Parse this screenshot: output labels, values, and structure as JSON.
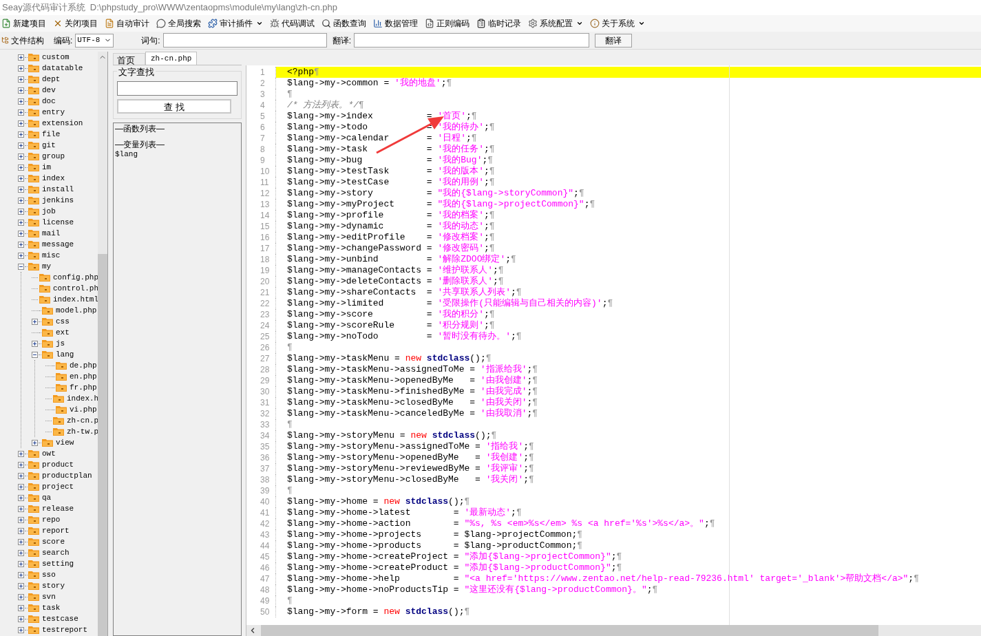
{
  "window": {
    "title": "Seay源代码审计系统  D:\\phpstudy_pro\\WWW\\zentaopms\\module\\my\\lang\\zh-cn.php"
  },
  "toolbar": [
    {
      "label": "新建项目",
      "dropdown": false
    },
    {
      "label": "关闭项目",
      "dropdown": false
    },
    {
      "label": "自动审计",
      "dropdown": false
    },
    {
      "label": "全局搜索",
      "dropdown": false
    },
    {
      "label": "审计插件",
      "dropdown": true
    },
    {
      "label": "代码调试",
      "dropdown": false
    },
    {
      "label": "函数查询",
      "dropdown": false
    },
    {
      "label": "数据管理",
      "dropdown": false
    },
    {
      "label": "正则编码",
      "dropdown": false
    },
    {
      "label": "临时记录",
      "dropdown": false
    },
    {
      "label": "系统配置",
      "dropdown": true
    },
    {
      "label": "关于系统",
      "dropdown": true
    }
  ],
  "options_bar": {
    "file_tab": "文件结构",
    "encoding_label": "编码:",
    "encoding": "UTF-8",
    "phrase_label": "词句:",
    "translate_label": "翻译:",
    "translate_button": "翻译"
  },
  "file_tree": [
    {
      "label": "custom",
      "kind": "branch",
      "expanded": false
    },
    {
      "label": "datatable",
      "kind": "branch",
      "expanded": false
    },
    {
      "label": "dept",
      "kind": "branch",
      "expanded": false
    },
    {
      "label": "dev",
      "kind": "branch",
      "expanded": false
    },
    {
      "label": "doc",
      "kind": "branch",
      "expanded": false
    },
    {
      "label": "entry",
      "kind": "branch",
      "expanded": false
    },
    {
      "label": "extension",
      "kind": "branch",
      "expanded": false
    },
    {
      "label": "file",
      "kind": "branch",
      "expanded": false
    },
    {
      "label": "git",
      "kind": "branch",
      "expanded": false
    },
    {
      "label": "group",
      "kind": "branch",
      "expanded": false
    },
    {
      "label": "im",
      "kind": "branch",
      "expanded": false
    },
    {
      "label": "index",
      "kind": "branch",
      "expanded": false
    },
    {
      "label": "install",
      "kind": "branch",
      "expanded": false
    },
    {
      "label": "jenkins",
      "kind": "branch",
      "expanded": false
    },
    {
      "label": "job",
      "kind": "branch",
      "expanded": false
    },
    {
      "label": "license",
      "kind": "branch",
      "expanded": false
    },
    {
      "label": "mail",
      "kind": "branch",
      "expanded": false
    },
    {
      "label": "message",
      "kind": "branch",
      "expanded": false
    },
    {
      "label": "misc",
      "kind": "branch",
      "expanded": false
    },
    {
      "label": "my",
      "kind": "branch",
      "expanded": true,
      "children": [
        {
          "label": "config.php",
          "kind": "leaf"
        },
        {
          "label": "control.ph",
          "kind": "leaf"
        },
        {
          "label": "index.html",
          "kind": "leaf"
        },
        {
          "label": "model.php",
          "kind": "leaf"
        },
        {
          "label": "css",
          "kind": "branch",
          "expanded": false
        },
        {
          "label": "ext",
          "kind": "leaf"
        },
        {
          "label": "js",
          "kind": "branch",
          "expanded": false
        },
        {
          "label": "lang",
          "kind": "branch",
          "expanded": true,
          "children": [
            {
              "label": "de.php",
              "kind": "leaf"
            },
            {
              "label": "en.php",
              "kind": "leaf"
            },
            {
              "label": "fr.php",
              "kind": "leaf"
            },
            {
              "label": "index.h",
              "kind": "leaf"
            },
            {
              "label": "vi.php",
              "kind": "leaf"
            },
            {
              "label": "zh-cn.p",
              "kind": "leaf"
            },
            {
              "label": "zh-tw.p",
              "kind": "leaf"
            }
          ]
        },
        {
          "label": "view",
          "kind": "branch",
          "expanded": false
        }
      ]
    },
    {
      "label": "owt",
      "kind": "branch",
      "expanded": false
    },
    {
      "label": "product",
      "kind": "branch",
      "expanded": false
    },
    {
      "label": "productplan",
      "kind": "branch",
      "expanded": false
    },
    {
      "label": "project",
      "kind": "branch",
      "expanded": false
    },
    {
      "label": "qa",
      "kind": "branch",
      "expanded": false
    },
    {
      "label": "release",
      "kind": "branch",
      "expanded": false
    },
    {
      "label": "repo",
      "kind": "branch",
      "expanded": false
    },
    {
      "label": "report",
      "kind": "branch",
      "expanded": false
    },
    {
      "label": "score",
      "kind": "branch",
      "expanded": false
    },
    {
      "label": "search",
      "kind": "branch",
      "expanded": false
    },
    {
      "label": "setting",
      "kind": "branch",
      "expanded": false
    },
    {
      "label": "sso",
      "kind": "branch",
      "expanded": false
    },
    {
      "label": "story",
      "kind": "branch",
      "expanded": false
    },
    {
      "label": "svn",
      "kind": "branch",
      "expanded": false
    },
    {
      "label": "task",
      "kind": "branch",
      "expanded": false
    },
    {
      "label": "testcase",
      "kind": "branch",
      "expanded": false
    },
    {
      "label": "testreport",
      "kind": "branch",
      "expanded": false
    }
  ],
  "tabs": [
    {
      "label": "首页",
      "selected": false
    },
    {
      "label": "zh-cn.php",
      "selected": true
    }
  ],
  "find": {
    "title": "文字查找",
    "button": "查 找"
  },
  "outline": [
    {
      "kind": "heading",
      "text": "—函数列表—"
    },
    {
      "kind": "heading",
      "text": "—变量列表—"
    },
    {
      "kind": "item",
      "text": "$lang"
    }
  ],
  "editor": {
    "lines": [
      {
        "n": "1",
        "current": true,
        "segs": [
          {
            "kind": "code",
            "text": "<?php"
          },
          {
            "kind": "mark",
            "text": "¶"
          }
        ]
      },
      {
        "n": "2",
        "current": false,
        "segs": [
          {
            "kind": "code",
            "text": "$lang->my->common = "
          },
          {
            "kind": "string",
            "text": "'我的地盘'"
          },
          {
            "kind": "code",
            "text": ";"
          },
          {
            "kind": "mark",
            "text": "¶"
          }
        ]
      },
      {
        "n": "3",
        "current": false,
        "segs": [
          {
            "kind": "mark",
            "text": "¶"
          }
        ]
      },
      {
        "n": "4",
        "current": false,
        "segs": [
          {
            "kind": "comment",
            "text": "/* 方法列表。*/"
          },
          {
            "kind": "mark",
            "text": "¶"
          }
        ]
      },
      {
        "n": "5",
        "current": false,
        "segs": [
          {
            "kind": "code",
            "text": "$lang->my->index          = "
          },
          {
            "kind": "string",
            "text": "'首页'"
          },
          {
            "kind": "code",
            "text": ";"
          },
          {
            "kind": "mark",
            "text": "¶"
          }
        ]
      },
      {
        "n": "6",
        "current": false,
        "segs": [
          {
            "kind": "code",
            "text": "$lang->my->todo           = "
          },
          {
            "kind": "string",
            "text": "'我的待办'"
          },
          {
            "kind": "code",
            "text": ";"
          },
          {
            "kind": "mark",
            "text": "¶"
          }
        ]
      },
      {
        "n": "7",
        "current": false,
        "segs": [
          {
            "kind": "code",
            "text": "$lang->my->calendar       = "
          },
          {
            "kind": "string",
            "text": "'日程'"
          },
          {
            "kind": "code",
            "text": ";"
          },
          {
            "kind": "mark",
            "text": "¶"
          }
        ]
      },
      {
        "n": "8",
        "current": false,
        "segs": [
          {
            "kind": "code",
            "text": "$lang->my->task           = "
          },
          {
            "kind": "string",
            "text": "'我的任务'"
          },
          {
            "kind": "code",
            "text": ";"
          },
          {
            "kind": "mark",
            "text": "¶"
          }
        ]
      },
      {
        "n": "9",
        "current": false,
        "segs": [
          {
            "kind": "code",
            "text": "$lang->my->bug            = "
          },
          {
            "kind": "string",
            "text": "'我的Bug'"
          },
          {
            "kind": "code",
            "text": ";"
          },
          {
            "kind": "mark",
            "text": "¶"
          }
        ]
      },
      {
        "n": "10",
        "current": false,
        "segs": [
          {
            "kind": "code",
            "text": "$lang->my->testTask       = "
          },
          {
            "kind": "string",
            "text": "'我的版本'"
          },
          {
            "kind": "code",
            "text": ";"
          },
          {
            "kind": "mark",
            "text": "¶"
          }
        ]
      },
      {
        "n": "11",
        "current": false,
        "segs": [
          {
            "kind": "code",
            "text": "$lang->my->testCase       = "
          },
          {
            "kind": "string",
            "text": "'我的用例'"
          },
          {
            "kind": "code",
            "text": ";"
          },
          {
            "kind": "mark",
            "text": "¶"
          }
        ]
      },
      {
        "n": "12",
        "current": false,
        "segs": [
          {
            "kind": "code",
            "text": "$lang->my->story          = "
          },
          {
            "kind": "string",
            "text": "\"我的{$lang->storyCommon}\""
          },
          {
            "kind": "code",
            "text": ";"
          },
          {
            "kind": "mark",
            "text": "¶"
          }
        ]
      },
      {
        "n": "13",
        "current": false,
        "segs": [
          {
            "kind": "code",
            "text": "$lang->my->myProject      = "
          },
          {
            "kind": "string",
            "text": "\"我的{$lang->projectCommon}\""
          },
          {
            "kind": "code",
            "text": ";"
          },
          {
            "kind": "mark",
            "text": "¶"
          }
        ]
      },
      {
        "n": "14",
        "current": false,
        "segs": [
          {
            "kind": "code",
            "text": "$lang->my->profile        = "
          },
          {
            "kind": "string",
            "text": "'我的档案'"
          },
          {
            "kind": "code",
            "text": ";"
          },
          {
            "kind": "mark",
            "text": "¶"
          }
        ]
      },
      {
        "n": "15",
        "current": false,
        "segs": [
          {
            "kind": "code",
            "text": "$lang->my->dynamic        = "
          },
          {
            "kind": "string",
            "text": "'我的动态'"
          },
          {
            "kind": "code",
            "text": ";"
          },
          {
            "kind": "mark",
            "text": "¶"
          }
        ]
      },
      {
        "n": "16",
        "current": false,
        "segs": [
          {
            "kind": "code",
            "text": "$lang->my->editProfile    = "
          },
          {
            "kind": "string",
            "text": "'修改档案'"
          },
          {
            "kind": "code",
            "text": ";"
          },
          {
            "kind": "mark",
            "text": "¶"
          }
        ]
      },
      {
        "n": "17",
        "current": false,
        "segs": [
          {
            "kind": "code",
            "text": "$lang->my->changePassword = "
          },
          {
            "kind": "string",
            "text": "'修改密码'"
          },
          {
            "kind": "code",
            "text": ";"
          },
          {
            "kind": "mark",
            "text": "¶"
          }
        ]
      },
      {
        "n": "18",
        "current": false,
        "segs": [
          {
            "kind": "code",
            "text": "$lang->my->unbind         = "
          },
          {
            "kind": "string",
            "text": "'解除ZDOO绑定'"
          },
          {
            "kind": "code",
            "text": ";"
          },
          {
            "kind": "mark",
            "text": "¶"
          }
        ]
      },
      {
        "n": "19",
        "current": false,
        "segs": [
          {
            "kind": "code",
            "text": "$lang->my->manageContacts = "
          },
          {
            "kind": "string",
            "text": "'维护联系人'"
          },
          {
            "kind": "code",
            "text": ";"
          },
          {
            "kind": "mark",
            "text": "¶"
          }
        ]
      },
      {
        "n": "20",
        "current": false,
        "segs": [
          {
            "kind": "code",
            "text": "$lang->my->deleteContacts = "
          },
          {
            "kind": "string",
            "text": "'删除联系人'"
          },
          {
            "kind": "code",
            "text": ";"
          },
          {
            "kind": "mark",
            "text": "¶"
          }
        ]
      },
      {
        "n": "21",
        "current": false,
        "segs": [
          {
            "kind": "code",
            "text": "$lang->my->shareContacts  = "
          },
          {
            "kind": "string",
            "text": "'共享联系人列表'"
          },
          {
            "kind": "code",
            "text": ";"
          },
          {
            "kind": "mark",
            "text": "¶"
          }
        ]
      },
      {
        "n": "22",
        "current": false,
        "segs": [
          {
            "kind": "code",
            "text": "$lang->my->limited        = "
          },
          {
            "kind": "string",
            "text": "'受限操作(只能编辑与自己相关的内容)'"
          },
          {
            "kind": "code",
            "text": ";"
          },
          {
            "kind": "mark",
            "text": "¶"
          }
        ]
      },
      {
        "n": "23",
        "current": false,
        "segs": [
          {
            "kind": "code",
            "text": "$lang->my->score          = "
          },
          {
            "kind": "string",
            "text": "'我的积分'"
          },
          {
            "kind": "code",
            "text": ";"
          },
          {
            "kind": "mark",
            "text": "¶"
          }
        ]
      },
      {
        "n": "24",
        "current": false,
        "segs": [
          {
            "kind": "code",
            "text": "$lang->my->scoreRule      = "
          },
          {
            "kind": "string",
            "text": "'积分规则'"
          },
          {
            "kind": "code",
            "text": ";"
          },
          {
            "kind": "mark",
            "text": "¶"
          }
        ]
      },
      {
        "n": "25",
        "current": false,
        "segs": [
          {
            "kind": "code",
            "text": "$lang->my->noTodo         = "
          },
          {
            "kind": "string",
            "text": "'暂时没有待办。'"
          },
          {
            "kind": "code",
            "text": ";"
          },
          {
            "kind": "mark",
            "text": "¶"
          }
        ]
      },
      {
        "n": "26",
        "current": false,
        "segs": [
          {
            "kind": "mark",
            "text": "¶"
          }
        ]
      },
      {
        "n": "27",
        "current": false,
        "segs": [
          {
            "kind": "code",
            "text": "$lang->my->taskMenu = "
          },
          {
            "kind": "keyword",
            "text": "new"
          },
          {
            "kind": "class",
            "text": "stdclass"
          },
          {
            "kind": "code",
            "text": "();"
          },
          {
            "kind": "mark",
            "text": "¶"
          }
        ]
      },
      {
        "n": "28",
        "current": false,
        "segs": [
          {
            "kind": "code",
            "text": "$lang->my->taskMenu->assignedToMe = "
          },
          {
            "kind": "string",
            "text": "'指派给我'"
          },
          {
            "kind": "code",
            "text": ";"
          },
          {
            "kind": "mark",
            "text": "¶"
          }
        ]
      },
      {
        "n": "29",
        "current": false,
        "segs": [
          {
            "kind": "code",
            "text": "$lang->my->taskMenu->openedByMe   = "
          },
          {
            "kind": "string",
            "text": "'由我创建'"
          },
          {
            "kind": "code",
            "text": ";"
          },
          {
            "kind": "mark",
            "text": "¶"
          }
        ]
      },
      {
        "n": "30",
        "current": false,
        "segs": [
          {
            "kind": "code",
            "text": "$lang->my->taskMenu->finishedByMe = "
          },
          {
            "kind": "string",
            "text": "'由我完成'"
          },
          {
            "kind": "code",
            "text": ";"
          },
          {
            "kind": "mark",
            "text": "¶"
          }
        ]
      },
      {
        "n": "31",
        "current": false,
        "segs": [
          {
            "kind": "code",
            "text": "$lang->my->taskMenu->closedByMe   = "
          },
          {
            "kind": "string",
            "text": "'由我关闭'"
          },
          {
            "kind": "code",
            "text": ";"
          },
          {
            "kind": "mark",
            "text": "¶"
          }
        ]
      },
      {
        "n": "32",
        "current": false,
        "segs": [
          {
            "kind": "code",
            "text": "$lang->my->taskMenu->canceledByMe = "
          },
          {
            "kind": "string",
            "text": "'由我取消'"
          },
          {
            "kind": "code",
            "text": ";"
          },
          {
            "kind": "mark",
            "text": "¶"
          }
        ]
      },
      {
        "n": "33",
        "current": false,
        "segs": [
          {
            "kind": "mark",
            "text": "¶"
          }
        ]
      },
      {
        "n": "34",
        "current": false,
        "segs": [
          {
            "kind": "code",
            "text": "$lang->my->storyMenu = "
          },
          {
            "kind": "keyword",
            "text": "new"
          },
          {
            "kind": "class",
            "text": "stdclass"
          },
          {
            "kind": "code",
            "text": "();"
          },
          {
            "kind": "mark",
            "text": "¶"
          }
        ]
      },
      {
        "n": "35",
        "current": false,
        "segs": [
          {
            "kind": "code",
            "text": "$lang->my->storyMenu->assignedToMe = "
          },
          {
            "kind": "string",
            "text": "'指给我'"
          },
          {
            "kind": "code",
            "text": ";"
          },
          {
            "kind": "mark",
            "text": "¶"
          }
        ]
      },
      {
        "n": "36",
        "current": false,
        "segs": [
          {
            "kind": "code",
            "text": "$lang->my->storyMenu->openedByMe   = "
          },
          {
            "kind": "string",
            "text": "'我创建'"
          },
          {
            "kind": "code",
            "text": ";"
          },
          {
            "kind": "mark",
            "text": "¶"
          }
        ]
      },
      {
        "n": "37",
        "current": false,
        "segs": [
          {
            "kind": "code",
            "text": "$lang->my->storyMenu->reviewedByMe = "
          },
          {
            "kind": "string",
            "text": "'我评审'"
          },
          {
            "kind": "code",
            "text": ";"
          },
          {
            "kind": "mark",
            "text": "¶"
          }
        ]
      },
      {
        "n": "38",
        "current": false,
        "segs": [
          {
            "kind": "code",
            "text": "$lang->my->storyMenu->closedByMe   = "
          },
          {
            "kind": "string",
            "text": "'我关闭'"
          },
          {
            "kind": "code",
            "text": ";"
          },
          {
            "kind": "mark",
            "text": "¶"
          }
        ]
      },
      {
        "n": "39",
        "current": false,
        "segs": [
          {
            "kind": "mark",
            "text": "¶"
          }
        ]
      },
      {
        "n": "40",
        "current": false,
        "segs": [
          {
            "kind": "code",
            "text": "$lang->my->home = "
          },
          {
            "kind": "keyword",
            "text": "new"
          },
          {
            "kind": "class",
            "text": "stdclass"
          },
          {
            "kind": "code",
            "text": "();"
          },
          {
            "kind": "mark",
            "text": "¶"
          }
        ]
      },
      {
        "n": "41",
        "current": false,
        "segs": [
          {
            "kind": "code",
            "text": "$lang->my->home->latest        = "
          },
          {
            "kind": "string",
            "text": "'最新动态'"
          },
          {
            "kind": "code",
            "text": ";"
          },
          {
            "kind": "mark",
            "text": "¶"
          }
        ]
      },
      {
        "n": "42",
        "current": false,
        "segs": [
          {
            "kind": "code",
            "text": "$lang->my->home->action        = "
          },
          {
            "kind": "string",
            "text": "\"%s, %s <em>%s</em> %s <a href='%s'>%s</a>。\""
          },
          {
            "kind": "code",
            "text": ";"
          },
          {
            "kind": "mark",
            "text": "¶"
          }
        ]
      },
      {
        "n": "43",
        "current": false,
        "segs": [
          {
            "kind": "code",
            "text": "$lang->my->home->projects      = $lang->projectCommon;"
          },
          {
            "kind": "mark",
            "text": "¶"
          }
        ]
      },
      {
        "n": "44",
        "current": false,
        "segs": [
          {
            "kind": "code",
            "text": "$lang->my->home->products      = $lang->productCommon;"
          },
          {
            "kind": "mark",
            "text": "¶"
          }
        ]
      },
      {
        "n": "45",
        "current": false,
        "segs": [
          {
            "kind": "code",
            "text": "$lang->my->home->createProject = "
          },
          {
            "kind": "string",
            "text": "\"添加{$lang->projectCommon}\""
          },
          {
            "kind": "code",
            "text": ";"
          },
          {
            "kind": "mark",
            "text": "¶"
          }
        ]
      },
      {
        "n": "46",
        "current": false,
        "segs": [
          {
            "kind": "code",
            "text": "$lang->my->home->createProduct = "
          },
          {
            "kind": "string",
            "text": "\"添加{$lang->productCommon}\""
          },
          {
            "kind": "code",
            "text": ";"
          },
          {
            "kind": "mark",
            "text": "¶"
          }
        ]
      },
      {
        "n": "47",
        "current": false,
        "segs": [
          {
            "kind": "code",
            "text": "$lang->my->home->help          = "
          },
          {
            "kind": "string",
            "text": "\"<a href='https://www.zentao.net/help-read-79236.html' target='_blank'>帮助文档</a>\""
          },
          {
            "kind": "code",
            "text": ";"
          },
          {
            "kind": "mark",
            "text": "¶"
          }
        ]
      },
      {
        "n": "48",
        "current": false,
        "segs": [
          {
            "kind": "code",
            "text": "$lang->my->home->noProductsTip = "
          },
          {
            "kind": "string",
            "text": "\"这里还没有{$lang->productCommon}。\""
          },
          {
            "kind": "code",
            "text": ";"
          },
          {
            "kind": "mark",
            "text": "¶"
          }
        ]
      },
      {
        "n": "49",
        "current": false,
        "segs": [
          {
            "kind": "mark",
            "text": "¶"
          }
        ]
      },
      {
        "n": "50",
        "current": false,
        "segs": [
          {
            "kind": "code",
            "text": "$lang->my->form = "
          },
          {
            "kind": "keyword",
            "text": "new"
          },
          {
            "kind": "class",
            "text": "stdclass"
          },
          {
            "kind": "code",
            "text": "();"
          },
          {
            "kind": "mark",
            "text": "¶"
          }
        ]
      }
    ]
  }
}
